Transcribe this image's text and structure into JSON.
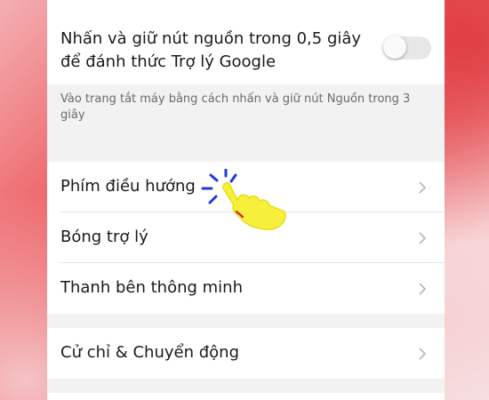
{
  "settings": {
    "power_button_toggle": {
      "label": "Nhấn và giữ nút nguồn trong 0,5 giây để đánh thức Trợ lý Google",
      "enabled": false
    },
    "power_button_hint": "Vào trang tắt máy bằng cách nhấn và giữ nút Nguồn trong 3 giây",
    "items": [
      {
        "label": "Phím điều hướng"
      },
      {
        "label": "Bóng trợ lý"
      },
      {
        "label": "Thanh bên thông minh"
      },
      {
        "label": "Cử chỉ & Chuyển động"
      }
    ]
  },
  "icons": {
    "row_chevron": "chevron-right-icon",
    "tap_indicator": "pointing-hand-icon"
  },
  "colors": {
    "panel_background": "#f2f2f2",
    "card_background": "#ffffff",
    "hand_fill": "#f7f03a",
    "tap_rays": "#1f3bd6"
  }
}
